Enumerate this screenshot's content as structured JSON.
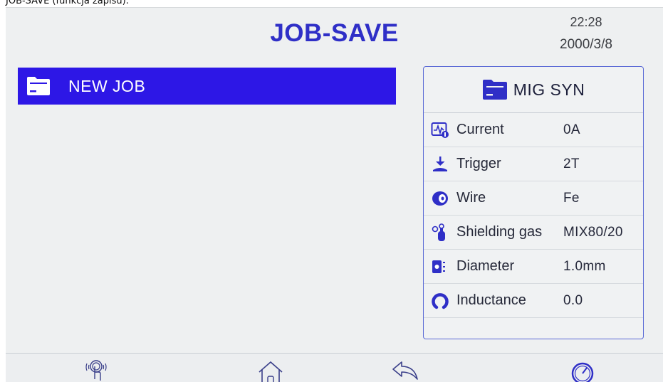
{
  "caption": "JOB-SAVE (funkcja zapisu).",
  "header": {
    "title": "JOB-SAVE",
    "time": "22:28",
    "date": "2000/3/8"
  },
  "job_list": {
    "items": [
      {
        "label": "NEW  JOB",
        "icon": "folder-icon",
        "selected": true
      }
    ],
    "selected_color": "#2d17e6"
  },
  "panel": {
    "mode": "MIG  SYN",
    "mode_icon": "folder-icon",
    "params": [
      {
        "label": "Current",
        "value": "0A",
        "icon": "current-waveform-icon"
      },
      {
        "label": "Trigger",
        "value": "2T",
        "icon": "trigger-icon"
      },
      {
        "label": "Wire",
        "value": "Fe",
        "icon": "wire-spool-icon"
      },
      {
        "label": "Shielding gas",
        "value": "MIX80/20",
        "icon": "gas-cylinder-icon"
      },
      {
        "label": "Diameter",
        "value": "1.0mm",
        "icon": "diameter-icon"
      },
      {
        "label": "Inductance",
        "value": "0.0",
        "icon": "inductance-icon"
      }
    ]
  },
  "bottom_bar": {
    "buttons": [
      {
        "name": "touch",
        "icon": "touch-icon"
      },
      {
        "name": "home",
        "icon": "home-icon"
      },
      {
        "name": "back",
        "icon": "back-arrow-icon"
      },
      {
        "name": "knob",
        "icon": "knob-icon"
      }
    ]
  },
  "colors": {
    "title": "#2f2fc7",
    "accent": "#2d17e6",
    "icon": "#2f2fc7",
    "screen_bg": "#eef0f1"
  }
}
